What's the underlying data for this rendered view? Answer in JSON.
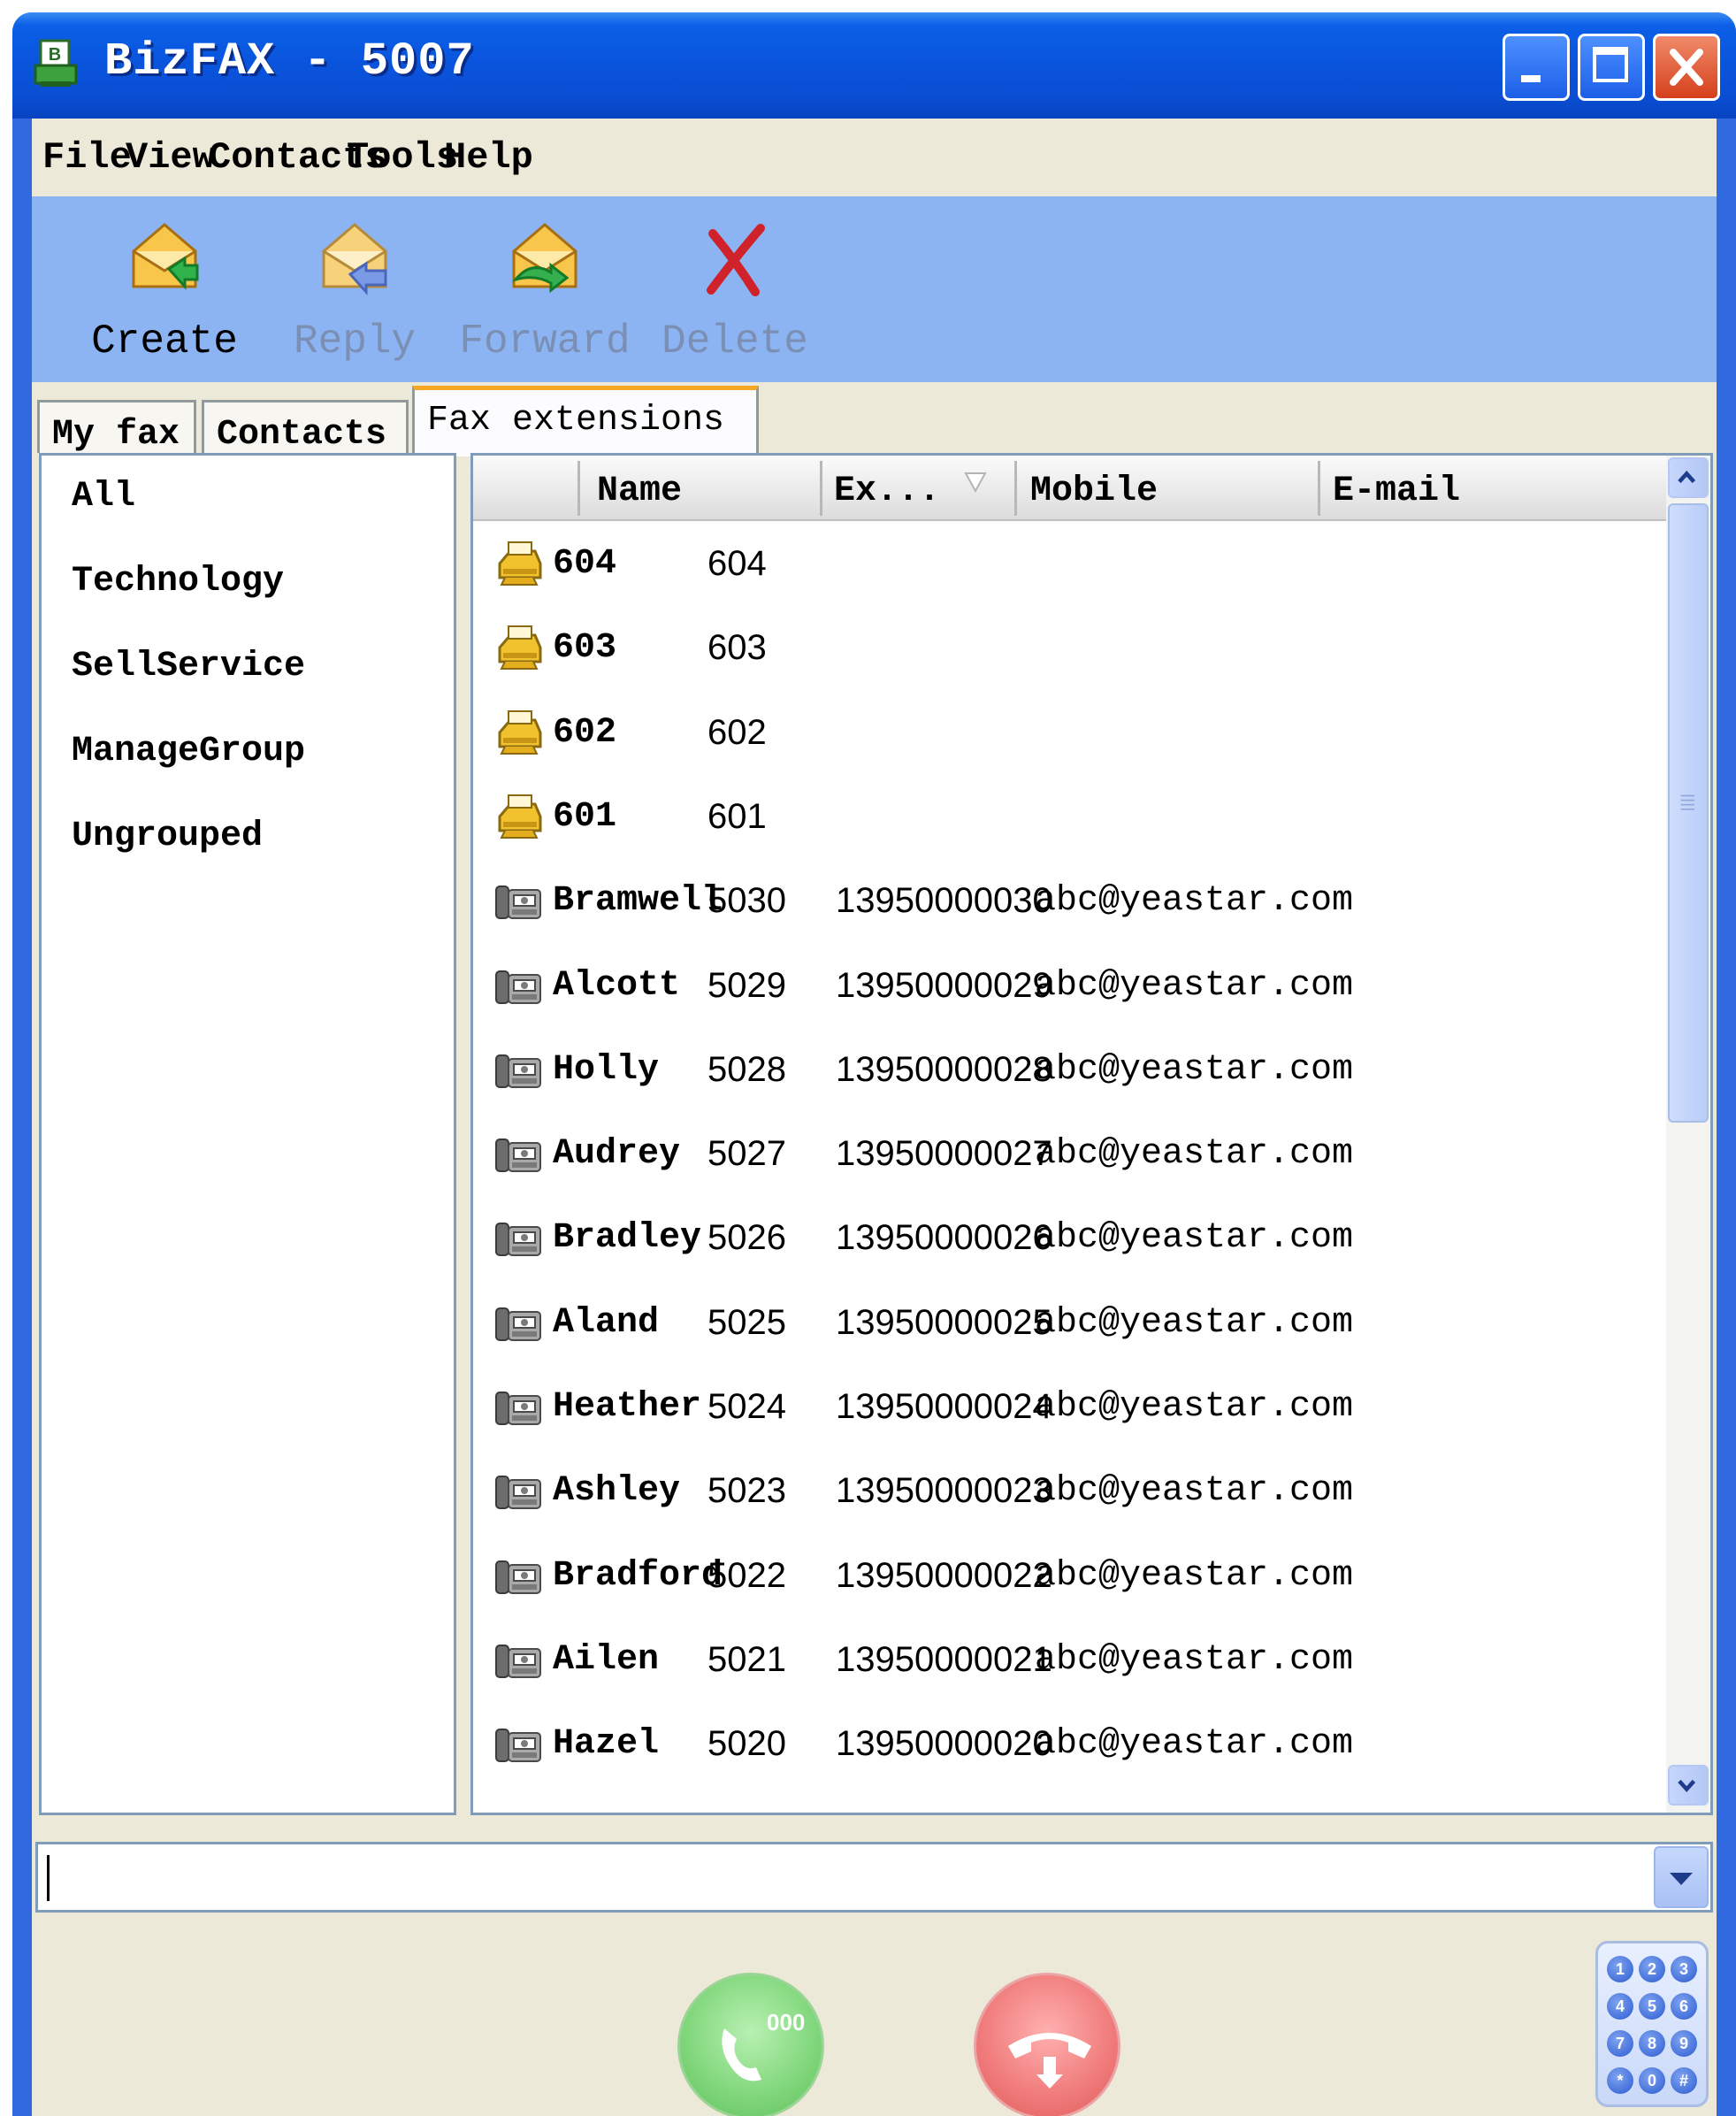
{
  "window": {
    "title": "BizFAX - 5007"
  },
  "menu": {
    "items": [
      "File",
      "View",
      "Contacts",
      "Tools",
      "Help"
    ]
  },
  "toolbar": {
    "create": "Create",
    "reply": "Reply",
    "forward": "Forward",
    "delete": "Delete"
  },
  "tabs": {
    "items": [
      "My fax",
      "Contacts",
      "Fax extensions"
    ],
    "active": "Fax extensions"
  },
  "groups": {
    "items": [
      "All",
      "Technology",
      "SellService",
      "ManageGroup",
      "Ungrouped"
    ]
  },
  "table": {
    "columns": {
      "name": "Name",
      "ext": "Ex...",
      "mobile": "Mobile",
      "email": "E-mail"
    },
    "rows": [
      {
        "icon": "fax-machine-icon",
        "name": "604",
        "ext": "604",
        "mobile": "",
        "email": ""
      },
      {
        "icon": "fax-machine-icon",
        "name": "603",
        "ext": "603",
        "mobile": "",
        "email": ""
      },
      {
        "icon": "fax-machine-icon",
        "name": "602",
        "ext": "602",
        "mobile": "",
        "email": ""
      },
      {
        "icon": "fax-machine-icon",
        "name": "601",
        "ext": "601",
        "mobile": "",
        "email": ""
      },
      {
        "icon": "phone-fax-icon",
        "name": "Bramwell",
        "ext": "5030",
        "mobile": "13950000030",
        "email": "abc@yeastar.com"
      },
      {
        "icon": "phone-fax-icon",
        "name": "Alcott",
        "ext": "5029",
        "mobile": "13950000029",
        "email": "abc@yeastar.com"
      },
      {
        "icon": "phone-fax-icon",
        "name": "Holly",
        "ext": "5028",
        "mobile": "13950000028",
        "email": "abc@yeastar.com"
      },
      {
        "icon": "phone-fax-icon",
        "name": "Audrey",
        "ext": "5027",
        "mobile": "13950000027",
        "email": "abc@yeastar.com"
      },
      {
        "icon": "phone-fax-icon",
        "name": "Bradley",
        "ext": "5026",
        "mobile": "13950000026",
        "email": "abc@yeastar.com"
      },
      {
        "icon": "phone-fax-icon",
        "name": "Aland",
        "ext": "5025",
        "mobile": "13950000025",
        "email": "abc@yeastar.com"
      },
      {
        "icon": "phone-fax-icon",
        "name": "Heather",
        "ext": "5024",
        "mobile": "13950000024",
        "email": "abc@yeastar.com"
      },
      {
        "icon": "phone-fax-icon",
        "name": "Ashley",
        "ext": "5023",
        "mobile": "13950000023",
        "email": "abc@yeastar.com"
      },
      {
        "icon": "phone-fax-icon",
        "name": "Bradford",
        "ext": "5022",
        "mobile": "13950000022",
        "email": "abc@yeastar.com"
      },
      {
        "icon": "phone-fax-icon",
        "name": "Ailen",
        "ext": "5021",
        "mobile": "13950000021",
        "email": "abc@yeastar.com"
      },
      {
        "icon": "phone-fax-icon",
        "name": "Hazel",
        "ext": "5020",
        "mobile": "13950000020",
        "email": "abc@yeastar.com"
      }
    ]
  },
  "dial": {
    "value": "",
    "call_button_label": "000"
  },
  "keypad": {
    "keys": [
      "1",
      "2",
      "3",
      "4",
      "5",
      "6",
      "7",
      "8",
      "9",
      "*",
      "0",
      "#"
    ]
  },
  "colors": {
    "titlebar": "#0a55de",
    "toolbar": "#8cb4f3",
    "window_bg": "#ece9d8",
    "active_tab_accent": "#f5a623",
    "panel_border": "#7f9db9",
    "call_green": "#7fd67a",
    "hangup_red": "#f07a7a"
  }
}
